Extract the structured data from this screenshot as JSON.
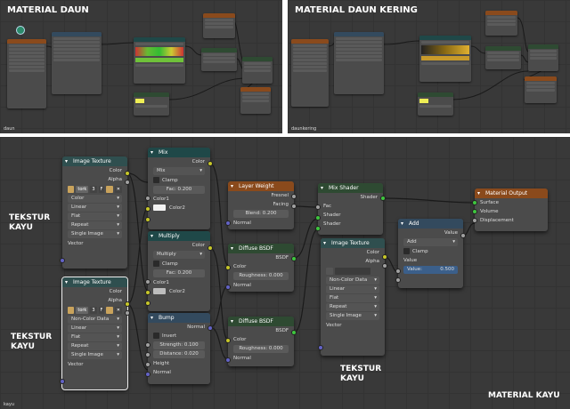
{
  "panels": {
    "top_left": {
      "title": "MATERIAL DAUN",
      "footer": "daun"
    },
    "top_right": {
      "title": "MATERIAL DAUN KERING",
      "footer": "daunkering"
    },
    "bottom": {
      "footer": "kayu"
    }
  },
  "annotations": {
    "tekstur1": "TEKSTUR KAYU",
    "tekstur2": "TEKSTUR KAYU",
    "tekstur3": "TEKSTUR KAYU",
    "material": "MATERIAL KAYU"
  },
  "mini": {
    "tex_coord": "Texture Coordinate",
    "mapping": "Mapping",
    "colorramp": "ColorRamp",
    "layer_weight": "Layer Weight",
    "diffuse": "Diffuse BSDF",
    "mix_shader": "Mix Shader",
    "translucent": "Translucent BSDF",
    "mat_out": "Material Output"
  },
  "nodes": {
    "imgtex1": {
      "title": "Image Texture",
      "color": "Color",
      "alpha": "Alpha",
      "img": "tork",
      "users": "3",
      "fake": "F",
      "colorspace": "Color",
      "interp": "Linear",
      "proj": "Flat",
      "ext": "Repeat",
      "source": "Single Image",
      "vector": "Vector"
    },
    "imgtex2": {
      "title": "Image Texture",
      "color": "Color",
      "alpha": "Alpha",
      "img": "tork",
      "users": "3",
      "fake": "F",
      "colorspace": "Non-Color Data",
      "interp": "Linear",
      "proj": "Flat",
      "ext": "Repeat",
      "source": "Single Image",
      "vector": "Vector"
    },
    "mix": {
      "title": "Mix",
      "out": "Color",
      "mode": "Mix",
      "clamp": "Clamp",
      "fac": "Fac:",
      "fac_val": "0.200",
      "c1": "Color1",
      "c2": "Color2"
    },
    "multiply": {
      "title": "Multiply",
      "out": "Color",
      "mode": "Multiply",
      "clamp": "Clamp",
      "fac": "Fac:",
      "fac_val": "0.200",
      "c1": "Color1",
      "c2": "Color2"
    },
    "bump": {
      "title": "Bump",
      "out": "Normal",
      "invert": "Invert",
      "strength": "Strength:",
      "strength_val": "0.100",
      "distance": "Distance:",
      "distance_val": "0.020",
      "height": "Height",
      "normal": "Normal"
    },
    "layerweight": {
      "title": "Layer Weight",
      "fresnel": "Fresnel",
      "facing": "Facing",
      "blend": "Blend:",
      "blend_val": "0.200",
      "normal": "Normal"
    },
    "diffuse1": {
      "title": "Diffuse BSDF",
      "out": "BSDF",
      "color": "Color",
      "rough": "Roughness:",
      "rough_val": "0.000",
      "normal": "Normal"
    },
    "diffuse2": {
      "title": "Diffuse BSDF",
      "out": "BSDF",
      "color": "Color",
      "rough": "Roughness:",
      "rough_val": "0.000",
      "normal": "Normal"
    },
    "mixshader": {
      "title": "Mix Shader",
      "out": "Shader",
      "fac": "Fac",
      "s1": "Shader",
      "s2": "Shader"
    },
    "imgtex3": {
      "title": "Image Texture",
      "color": "Color",
      "alpha": "Alpha",
      "colorspace": "Non-Color Data",
      "interp": "Linear",
      "proj": "Flat",
      "ext": "Repeat",
      "source": "Single Image",
      "vector": "Vector"
    },
    "add": {
      "title": "Add",
      "out": "Value",
      "mode": "Add",
      "clamp": "Clamp",
      "value": "Value",
      "val_label": "Value:",
      "val_num": "0.500"
    },
    "matout": {
      "title": "Material Output",
      "surface": "Surface",
      "volume": "Volume",
      "displacement": "Displacement"
    }
  },
  "colors": {
    "socket_color": "#c7c729",
    "socket_float": "#a1a1a1",
    "socket_vector": "#6363c7",
    "socket_shader": "#3fc63f",
    "wire": "#1a1a1a"
  }
}
